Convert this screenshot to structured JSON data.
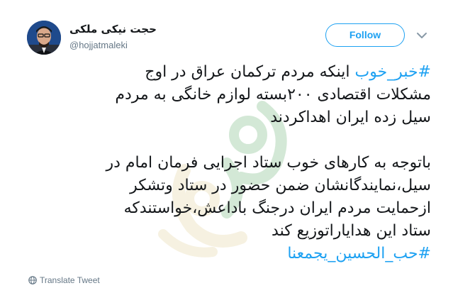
{
  "author": {
    "display_name": "حجت نیکی ملکی",
    "handle": "@hojjatmaleki"
  },
  "follow_button": {
    "label": "Follow"
  },
  "tweet": {
    "line1_hashtag": "#خبر_خوب",
    "line1_rest": " اینکه مردم ترکمان عراق در اوج",
    "line2": "مشکلات اقتصادی ۲۰۰بسته لوازم خانگی به مردم",
    "line3": "سیل زده ایران اهداکردند",
    "line4": "باتوجه به کارهای خوب ستاد اجرایی فرمان امام در",
    "line5": "سیل،نمایندگانشان ضمن حضور در ستاد وتشکر",
    "line6": "ازحمایت مردم ایران درجنگ باداعش،خواستندکه",
    "line7": "ستاد این هدایاراتوزیع کند",
    "line8_hashtag": "#حب_الحسین_یجمعنا"
  },
  "translate": {
    "label": "Translate Tweet"
  },
  "colors": {
    "accent": "#1da1f2",
    "text": "#14171a",
    "muted": "#657786",
    "watermark_green": "#3c9a4a",
    "watermark_gold": "#d9c27a"
  },
  "icons": {
    "avatar": "profile-photo",
    "chevron": "chevron-down-icon",
    "globe": "globe-icon",
    "watermark": "watermark-logo"
  }
}
